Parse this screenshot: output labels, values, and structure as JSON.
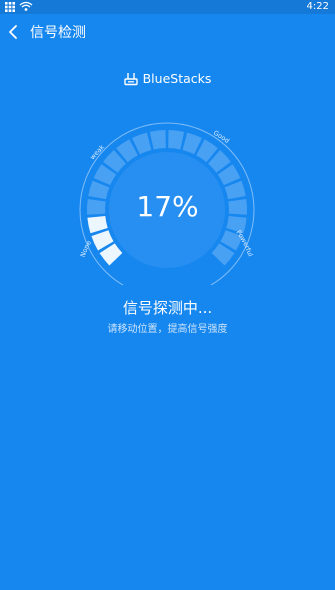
{
  "status_bar": {
    "time": "4:22"
  },
  "header": {
    "title": "信号检测",
    "back_icon": "chevron-left-icon"
  },
  "device": {
    "name": "BlueStacks",
    "icon": "router-icon"
  },
  "gauge": {
    "value_text": "17%",
    "level": 0.17,
    "labels": {
      "none": "None",
      "weak": "weak",
      "good": "Good",
      "powerful": "Powerful"
    }
  },
  "status": {
    "title": "信号探测中...",
    "subtitle": "请移动位置，提高信号强度"
  },
  "colors": {
    "background": "#1787F0",
    "status_bar": "#1579D8",
    "accent_text": "#FFFFFF"
  }
}
